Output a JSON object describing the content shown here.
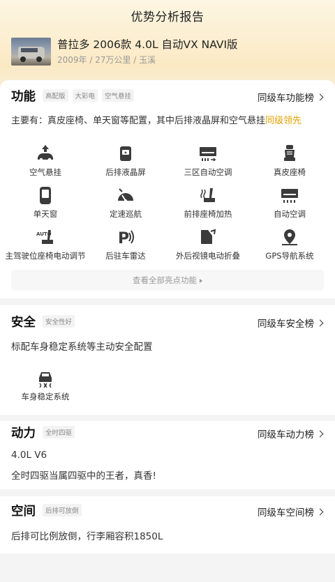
{
  "page": {
    "title": "优势分析报告"
  },
  "car": {
    "name": "普拉多 2006款 4.0L 自动VX NAVI版",
    "meta": "2009年 / 27万公里 / 玉溪"
  },
  "function": {
    "title": "功能",
    "tags": [
      "高配版",
      "大彩电",
      "空气悬挂"
    ],
    "rank_link": "同级车功能榜",
    "desc_main": "主要有：真皮座椅、单天窗等配置，其中后排液晶屏和空气悬挂",
    "desc_highlight": "同级领先",
    "features": [
      {
        "label": "空气悬挂",
        "icon": "air-suspension-icon"
      },
      {
        "label": "后排液晶屏",
        "icon": "rear-screen-icon"
      },
      {
        "label": "三区自动空调",
        "icon": "tri-zone-ac-icon"
      },
      {
        "label": "真皮座椅",
        "icon": "leather-seat-icon"
      },
      {
        "label": "单天窗",
        "icon": "sunroof-icon"
      },
      {
        "label": "定速巡航",
        "icon": "cruise-control-icon"
      },
      {
        "label": "前排座椅加热",
        "icon": "seat-heating-icon"
      },
      {
        "label": "自动空调",
        "icon": "auto-ac-icon"
      },
      {
        "label": "主驾驶位座椅电动调节",
        "icon": "power-seat-icon"
      },
      {
        "label": "后驻车雷达",
        "icon": "parking-radar-icon"
      },
      {
        "label": "外后视镜电动折叠",
        "icon": "mirror-fold-icon"
      },
      {
        "label": "GPS导航系统",
        "icon": "gps-icon"
      }
    ],
    "view_all": "查看全部亮点功能"
  },
  "safety": {
    "title": "安全",
    "tags": [
      "安全性好"
    ],
    "rank_link": "同级车安全榜",
    "desc": "标配车身稳定系统等主动安全配置",
    "features": [
      {
        "label": "车身稳定系统",
        "icon": "stability-control-icon"
      }
    ]
  },
  "power": {
    "title": "动力",
    "tags": [
      "全时四驱"
    ],
    "rank_link": "同级车动力榜",
    "engine": "4.0L V6",
    "desc": "全时四驱当属四驱中的王者，真香!"
  },
  "space": {
    "title": "空间",
    "tags": [
      "后排可放倒"
    ],
    "rank_link": "同级车空间榜",
    "desc": "后排可比例放倒，行李厢容积1850L"
  },
  "colors": {
    "accent": "#e3a100",
    "header_bg": "#fbe9c4"
  }
}
